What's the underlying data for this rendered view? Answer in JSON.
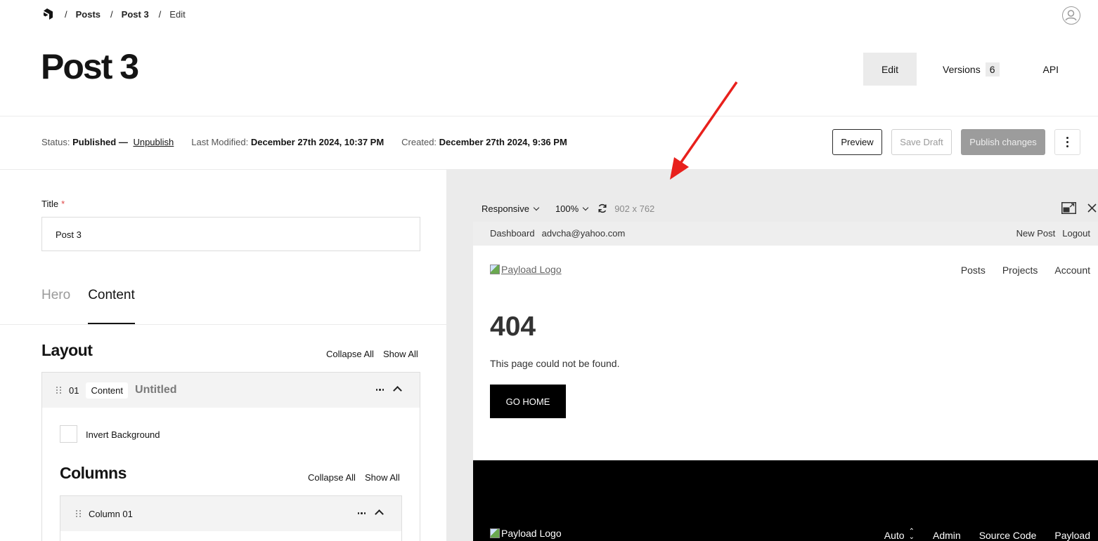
{
  "breadcrumb": {
    "items": [
      "Posts",
      "Post 3"
    ],
    "current": "Edit",
    "separator": "/"
  },
  "header": {
    "title": "Post 3"
  },
  "view_tabs": {
    "edit": "Edit",
    "versions": "Versions",
    "versions_count": "6",
    "api": "API"
  },
  "status_bar": {
    "status_label": "Status:",
    "status_value": "Published —",
    "unpublish": "Unpublish",
    "modified_label": "Last Modified:",
    "modified_value": "December 27th 2024, 10:37 PM",
    "created_label": "Created:",
    "created_value": "December 27th 2024, 9:36 PM"
  },
  "actions": {
    "preview": "Preview",
    "save_draft": "Save Draft",
    "publish": "Publish changes"
  },
  "form": {
    "title_label": "Title",
    "required_mark": "*",
    "title_value": "Post 3",
    "tabs": [
      "Hero",
      "Content"
    ],
    "active_tab": "Content",
    "layout_heading": "Layout",
    "collapse_all": "Collapse All",
    "show_all": "Show All",
    "block": {
      "number": "01",
      "type": "Content",
      "name": "Untitled"
    },
    "invert_label": "Invert Background",
    "invert_checked": false,
    "columns_heading": "Columns",
    "column_label": "Column 01"
  },
  "preview_panel": {
    "breakpoint": "Responsive",
    "zoom": "100%",
    "dimensions": "902 x 762",
    "admin_bar": {
      "dashboard": "Dashboard",
      "email": "advcha@yahoo.com",
      "new_post": "New Post",
      "logout": "Logout"
    },
    "logo_alt": "Payload Logo",
    "nav": [
      "Posts",
      "Projects",
      "Account"
    ],
    "error_code": "404",
    "error_message": "This page could not be found.",
    "go_home": "GO HOME",
    "footer": {
      "logo_alt": "Payload Logo",
      "theme": "Auto",
      "links": [
        "Admin",
        "Source Code",
        "Payload"
      ]
    }
  },
  "colors": {
    "arrow": "#e8201c",
    "primary_text": "#141414",
    "muted": "#9a9a9a",
    "panel_bg": "#ebebeb"
  }
}
